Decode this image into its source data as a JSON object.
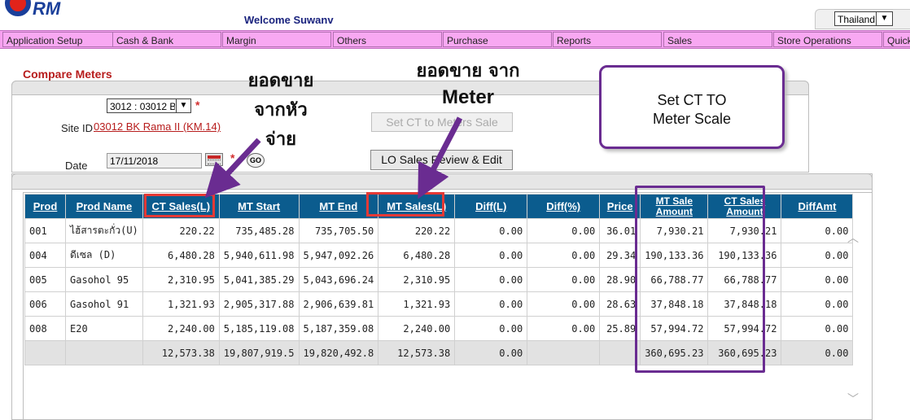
{
  "app": {
    "logo_text": "RM",
    "welcome": "Welcome Suwanv",
    "country": "Thailand"
  },
  "menu": [
    {
      "label": "Application Setup"
    },
    {
      "label": "Cash & Bank"
    },
    {
      "label": "Margin"
    },
    {
      "label": "Others"
    },
    {
      "label": "Purchase"
    },
    {
      "label": "Reports"
    },
    {
      "label": "Sales"
    },
    {
      "label": "Store Operations"
    },
    {
      "label": "Quick"
    }
  ],
  "page": {
    "title": "Compare Meters",
    "site_select_value": "3012 : 03012 B",
    "required_mark": "*",
    "site_label": "Site ID",
    "site_link": "03012 BK Rama II (KM.14)",
    "date_label": "Date",
    "date_value": "17/11/2018",
    "go_label": "GO",
    "set_ct_button": "Set CT to Meters Sale",
    "lo_button": "LO Sales Review & Edit"
  },
  "table": {
    "headers": [
      "Prod",
      "Prod Name",
      "CT Sales(L)",
      "MT Start",
      "MT End",
      "MT Sales(L)",
      "Diff(L)",
      "Diff(%)",
      "Price",
      "MT Sale Amount",
      "CT Sales Amount",
      "DiffAmt"
    ],
    "rows": [
      [
        "001",
        "ไฮ้สารตะกั่ว(U)",
        "220.22",
        "735,485.28",
        "735,705.50",
        "220.22",
        "0.00",
        "0.00",
        "36.01",
        "7,930.21",
        "7,930.21",
        "0.00"
      ],
      [
        "004",
        "ดีเซล (D)",
        "6,480.28",
        "5,940,611.98",
        "5,947,092.26",
        "6,480.28",
        "0.00",
        "0.00",
        "29.34",
        "190,133.36",
        "190,133.36",
        "0.00"
      ],
      [
        "005",
        "Gasohol 95",
        "2,310.95",
        "5,041,385.29",
        "5,043,696.24",
        "2,310.95",
        "0.00",
        "0.00",
        "28.90",
        "66,788.77",
        "66,788.77",
        "0.00"
      ],
      [
        "006",
        "Gasohol 91",
        "1,321.93",
        "2,905,317.88",
        "2,906,639.81",
        "1,321.93",
        "0.00",
        "0.00",
        "28.63",
        "37,848.18",
        "37,848.18",
        "0.00"
      ],
      [
        "008",
        "E20",
        "2,240.00",
        "5,185,119.08",
        "5,187,359.08",
        "2,240.00",
        "0.00",
        "0.00",
        "25.89",
        "57,994.72",
        "57,994.72",
        "0.00"
      ]
    ],
    "total": [
      "",
      "",
      "12,573.38",
      "19,807,919.5",
      "19,820,492.8",
      "12,573.38",
      "0.00",
      "",
      "",
      "360,695.23",
      "360,695.23",
      "0.00"
    ]
  },
  "annotations": {
    "ct_note": [
      "ยอดขาย",
      "จากหัว",
      "จ่าย"
    ],
    "meter_note": [
      "ยอดขาย จาก",
      "Meter"
    ],
    "callout": [
      "Set CT TO",
      "Meter Scale"
    ],
    "colors": {
      "red": "#e53935",
      "purple": "#6a2c91"
    }
  }
}
